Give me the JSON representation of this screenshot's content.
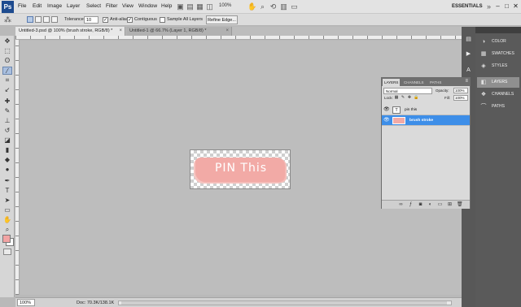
{
  "app": {
    "logo_text": "Ps",
    "zoom": "100%",
    "workspace": "ESSENTIALS"
  },
  "menu": [
    "File",
    "Edit",
    "Image",
    "Layer",
    "Select",
    "Filter",
    "View",
    "Window",
    "Help"
  ],
  "window_controls": [
    "–",
    "□",
    "✕"
  ],
  "options": {
    "tolerance_label": "Tolerance:",
    "tolerance_value": "10",
    "anti_alias_label": "Anti-alias",
    "anti_alias": true,
    "contiguous_label": "Contiguous",
    "contiguous": true,
    "sample_all_label": "Sample All Layers",
    "sample_all": false,
    "refine_edge": "Refine Edge..."
  },
  "tabs": [
    {
      "label": "Untitled-3.psd @ 100% (brush stroke, RGB/8) *",
      "active": true
    },
    {
      "label": "Untitled-1 @ 66.7% (Layer 1, RGB/8) *",
      "active": false
    }
  ],
  "canvas": {
    "text": "PIN This"
  },
  "status": {
    "zoom": "100%",
    "doc": "Doc: 70.3K/138.1K"
  },
  "dock": {
    "items": [
      {
        "label": "COLOR",
        "icon": "color-icon",
        "active": false
      },
      {
        "label": "SWATCHES",
        "icon": "swatches-icon",
        "active": false
      },
      {
        "label": "STYLES",
        "icon": "styles-icon",
        "active": false
      },
      {
        "label": "LAYERS",
        "icon": "layers-icon",
        "active": true
      },
      {
        "label": "CHANNELS",
        "icon": "channels-icon",
        "active": false
      },
      {
        "label": "PATHS",
        "icon": "paths-icon",
        "active": false
      }
    ]
  },
  "layers_panel": {
    "tabs": [
      "LAYERS",
      "CHANNELS",
      "PATHS"
    ],
    "blend_mode": "Normal",
    "opacity_label": "Opacity:",
    "opacity": "100%",
    "lock_label": "Lock:",
    "fill_label": "Fill:",
    "fill": "100%",
    "layers": [
      {
        "name": "pin this",
        "type": "text",
        "thumb": "T",
        "selected": false
      },
      {
        "name": "brush stroke",
        "type": "image",
        "thumb": "",
        "selected": true
      }
    ]
  },
  "colors": {
    "foreground": "#f2a3a3",
    "background": "#ffffff",
    "selection": "#3d8ee8",
    "brush": "#f2aaa6"
  }
}
